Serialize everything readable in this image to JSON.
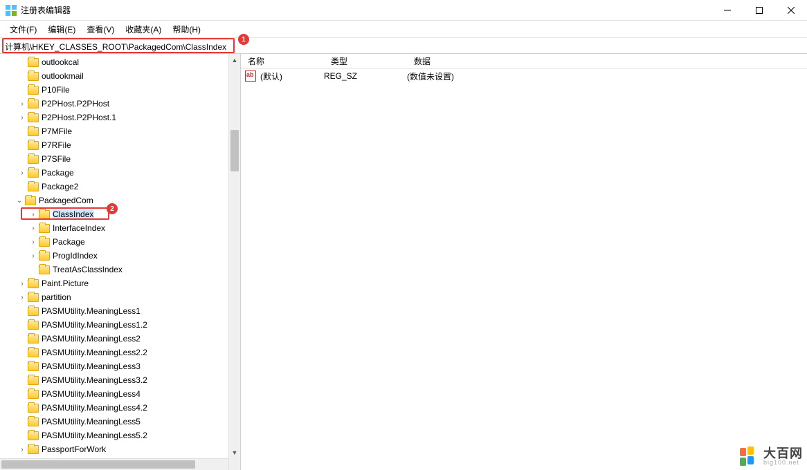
{
  "window": {
    "title": "注册表编辑器"
  },
  "menu": {
    "file": "文件(F)",
    "edit": "编辑(E)",
    "view": "查看(V)",
    "favorites": "收藏夹(A)",
    "help": "帮助(H)"
  },
  "address": {
    "path": "计算机\\HKEY_CLASSES_ROOT\\PackagedCom\\ClassIndex"
  },
  "callouts": {
    "one": "1",
    "two": "2"
  },
  "tree": {
    "items": [
      {
        "indent": 40,
        "expander": "",
        "label": "outlookcal"
      },
      {
        "indent": 40,
        "expander": "",
        "label": "outlookmail"
      },
      {
        "indent": 40,
        "expander": "",
        "label": "P10File"
      },
      {
        "indent": 26,
        "expander": "›",
        "label": "P2PHost.P2PHost"
      },
      {
        "indent": 26,
        "expander": "›",
        "label": "P2PHost.P2PHost.1"
      },
      {
        "indent": 40,
        "expander": "",
        "label": "P7MFile"
      },
      {
        "indent": 40,
        "expander": "",
        "label": "P7RFile"
      },
      {
        "indent": 40,
        "expander": "",
        "label": "P7SFile"
      },
      {
        "indent": 26,
        "expander": "›",
        "label": "Package"
      },
      {
        "indent": 40,
        "expander": "",
        "label": "Package2"
      },
      {
        "indent": 22,
        "expander": "⌄",
        "label": "PackagedCom"
      },
      {
        "indent": 42,
        "expander": "›",
        "label": "ClassIndex",
        "selected": true
      },
      {
        "indent": 42,
        "expander": "›",
        "label": "InterfaceIndex"
      },
      {
        "indent": 42,
        "expander": "›",
        "label": "Package"
      },
      {
        "indent": 42,
        "expander": "›",
        "label": "ProgIdIndex"
      },
      {
        "indent": 56,
        "expander": "",
        "label": "TreatAsClassIndex"
      },
      {
        "indent": 26,
        "expander": "›",
        "label": "Paint.Picture"
      },
      {
        "indent": 26,
        "expander": "›",
        "label": "partition"
      },
      {
        "indent": 40,
        "expander": "",
        "label": "PASMUtility.MeaningLess1"
      },
      {
        "indent": 40,
        "expander": "",
        "label": "PASMUtility.MeaningLess1.2"
      },
      {
        "indent": 40,
        "expander": "",
        "label": "PASMUtility.MeaningLess2"
      },
      {
        "indent": 40,
        "expander": "",
        "label": "PASMUtility.MeaningLess2.2"
      },
      {
        "indent": 40,
        "expander": "",
        "label": "PASMUtility.MeaningLess3"
      },
      {
        "indent": 40,
        "expander": "",
        "label": "PASMUtility.MeaningLess3.2"
      },
      {
        "indent": 40,
        "expander": "",
        "label": "PASMUtility.MeaningLess4"
      },
      {
        "indent": 40,
        "expander": "",
        "label": "PASMUtility.MeaningLess4.2"
      },
      {
        "indent": 40,
        "expander": "",
        "label": "PASMUtility.MeaningLess5"
      },
      {
        "indent": 40,
        "expander": "",
        "label": "PASMUtility.MeaningLess5.2"
      },
      {
        "indent": 26,
        "expander": "›",
        "label": "PassportForWork"
      }
    ]
  },
  "list": {
    "columns": {
      "name": "名称",
      "type": "类型",
      "data": "数据"
    },
    "rows": [
      {
        "name": "(默认)",
        "type": "REG_SZ",
        "data": "(数值未设置)"
      }
    ]
  },
  "watermark": {
    "brand": "大百网",
    "domain": "big100.net"
  }
}
